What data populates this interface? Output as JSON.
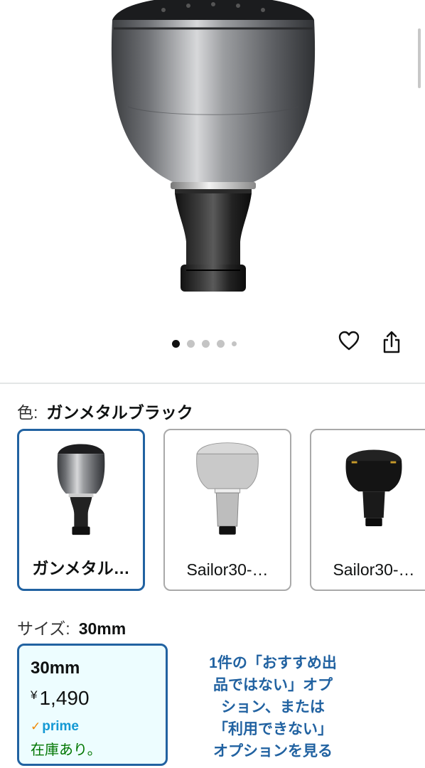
{
  "product_image": {
    "alt": "gunmetal black reel handle knob"
  },
  "carousel": {
    "total": 5,
    "active_index": 0
  },
  "actions": {
    "wishlist_icon": "heart-icon",
    "share_icon": "share-icon"
  },
  "color": {
    "label": "色:",
    "selected": "ガンメタルブラック",
    "options": [
      {
        "label": "ガンメタル…"
      },
      {
        "label": "Sailor30-…"
      },
      {
        "label": "Sailor30-…"
      }
    ]
  },
  "size": {
    "label": "サイズ:",
    "selected": "30mm",
    "card": {
      "name": "30mm",
      "currency": "¥",
      "price": "1,490",
      "prime": "prime",
      "stock": "在庫あり。"
    },
    "unavailable_link": [
      "1件の「おすすめ出",
      "品ではない」オプ",
      "ション、または",
      "「利用できない」",
      "オプションを見る"
    ]
  },
  "colors": {
    "accent": "#2162a1",
    "selected_bg": "#edfdff",
    "prime": "#1399d4",
    "in_stock": "#007600"
  }
}
